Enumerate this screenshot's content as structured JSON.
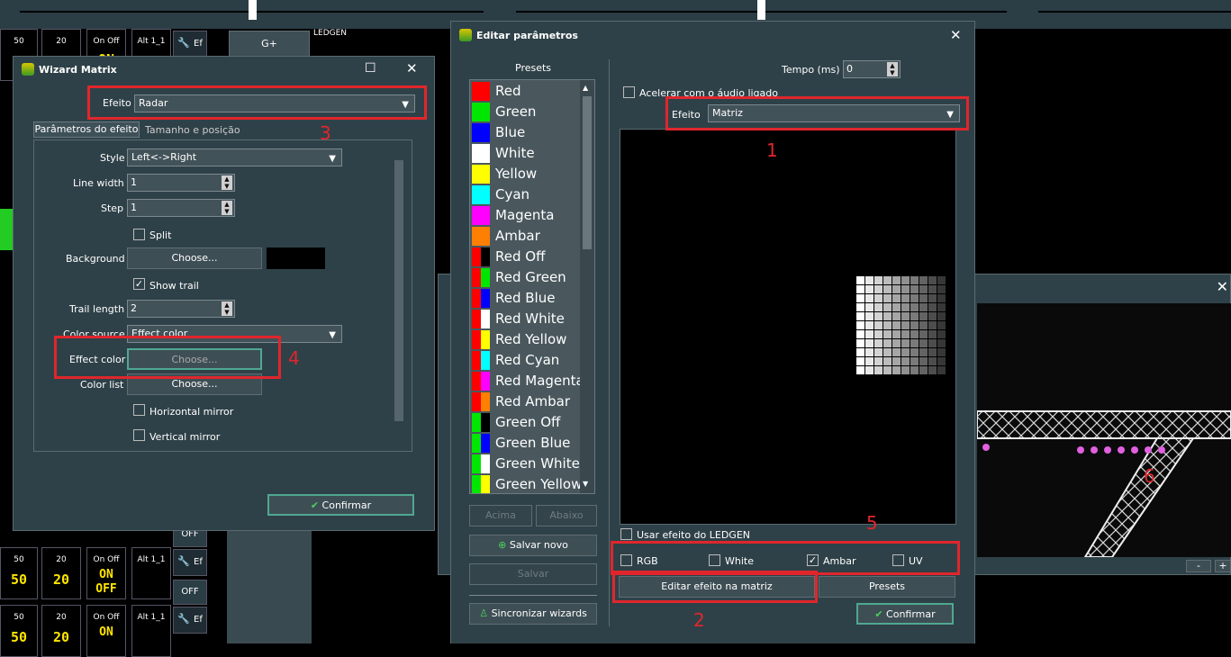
{
  "console": {
    "bank_top": [
      {
        "label": "50"
      },
      {
        "label": "20"
      },
      {
        "label": "On Off",
        "value": "ON"
      },
      {
        "label": "Alt 1_1"
      }
    ],
    "ef_label": "Ef",
    "off_label": "OFF",
    "gplus": "G+",
    "ledgen": "LEDGEN",
    "row_values": {
      "fifty": "50",
      "twenty": "20",
      "on": "ON",
      "off": "OFF",
      "alt": "Alt 1_1",
      "on_off": "On Off"
    }
  },
  "wizard": {
    "title": "Wizard Matrix",
    "effect_label": "Efeito",
    "effect_value": "Radar",
    "tabs": [
      "Parâmetros do efeito",
      "Tamanho e posição"
    ],
    "style_label": "Style",
    "style_value": "Left<->Right",
    "line_width_label": "Line width",
    "line_width_value": "1",
    "step_label": "Step",
    "step_value": "1",
    "split_label": "Split",
    "background_label": "Background",
    "choose_label": "Choose...",
    "show_trail_label": "Show trail",
    "trail_length_label": "Trail length",
    "trail_length_value": "2",
    "color_source_label": "Color source",
    "color_source_value": "Effect color",
    "effect_color_label": "Effect color",
    "color_list_label": "Color list",
    "hmirror_label": "Horizontal mirror",
    "vmirror_label": "Vertical mirror",
    "confirm_label": "Confirmar"
  },
  "editor": {
    "title": "Editar parâmetros",
    "presets_header": "Presets",
    "presets": [
      {
        "name": "Red",
        "c1": "#ff0000",
        "c2": "#ff0000"
      },
      {
        "name": "Green",
        "c1": "#00e600",
        "c2": "#00e600"
      },
      {
        "name": "Blue",
        "c1": "#0000ff",
        "c2": "#0000ff"
      },
      {
        "name": "White",
        "c1": "#ffffff",
        "c2": "#ffffff"
      },
      {
        "name": "Yellow",
        "c1": "#ffff00",
        "c2": "#ffff00"
      },
      {
        "name": "Cyan",
        "c1": "#00ffff",
        "c2": "#00ffff"
      },
      {
        "name": "Magenta",
        "c1": "#ff00ff",
        "c2": "#ff00ff"
      },
      {
        "name": "Ambar",
        "c1": "#ff7f00",
        "c2": "#ff7f00"
      },
      {
        "name": "Red Off",
        "c1": "#ff0000",
        "c2": "#000000"
      },
      {
        "name": "Red Green",
        "c1": "#ff0000",
        "c2": "#00e600"
      },
      {
        "name": "Red Blue",
        "c1": "#ff0000",
        "c2": "#0000ff"
      },
      {
        "name": "Red White",
        "c1": "#ff0000",
        "c2": "#ffffff"
      },
      {
        "name": "Red Yellow",
        "c1": "#ff0000",
        "c2": "#ffff00"
      },
      {
        "name": "Red Cyan",
        "c1": "#ff0000",
        "c2": "#00ffff"
      },
      {
        "name": "Red Magenta",
        "c1": "#ff0000",
        "c2": "#ff00ff"
      },
      {
        "name": "Red Ambar",
        "c1": "#ff0000",
        "c2": "#ff7f00"
      },
      {
        "name": "Green Off",
        "c1": "#00e600",
        "c2": "#000000"
      },
      {
        "name": "Green Blue",
        "c1": "#00e600",
        "c2": "#0000ff"
      },
      {
        "name": "Green White",
        "c1": "#00e600",
        "c2": "#ffffff"
      },
      {
        "name": "Green Yellow",
        "c1": "#00e600",
        "c2": "#ffff00"
      }
    ],
    "up_label": "Acima",
    "down_label": "Abaixo",
    "save_new_label": "Salvar novo",
    "save_label": "Salvar",
    "sync_label": "Sincronizar wizards",
    "tempo_label": "Tempo (ms)",
    "tempo_value": "0",
    "audio_label": "Acelerar com o áudio ligado",
    "efeito_label": "Efeito",
    "efeito_value": "Matriz",
    "use_ledgen_label": "Usar efeito do LEDGEN",
    "rgb_label": "RGB",
    "white_label": "White",
    "ambar_label": "Ambar",
    "uv_label": "UV",
    "edit_matrix_label": "Editar efeito na matriz",
    "presets_button": "Presets",
    "confirm_label": "Confirmar"
  },
  "annotations": [
    "1",
    "2",
    "3",
    "4",
    "5",
    "6"
  ],
  "viewer": {
    "minus": "-",
    "plus": "+"
  }
}
